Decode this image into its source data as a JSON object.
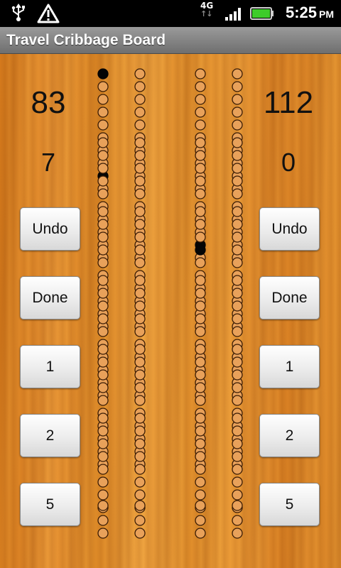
{
  "status_bar": {
    "network": "4G",
    "time": "5:25",
    "ampm": "PM",
    "icons": [
      "usb-icon",
      "warning-icon",
      "network-4g-icon",
      "signal-icon",
      "battery-icon"
    ]
  },
  "app": {
    "title": "Travel Cribbage Board"
  },
  "players": {
    "left": {
      "score": "83",
      "last": "7"
    },
    "right": {
      "score": "112",
      "last": "0"
    }
  },
  "buttons": {
    "left": [
      "Undo",
      "Done",
      "1",
      "2",
      "5"
    ],
    "right": [
      "Undo",
      "Done",
      "1",
      "2",
      "5"
    ]
  },
  "board": {
    "lanes": 4,
    "holes_per_lane": 60,
    "filled_pegs": [
      {
        "lane": 1,
        "hole": 1
      },
      {
        "lane": 1,
        "hole": 9
      },
      {
        "lane": 3,
        "hole": 19
      },
      {
        "lane": 3,
        "hole": 24
      }
    ],
    "colors": {
      "wood": "#e28f2c",
      "hole_fill": "#e8a15a",
      "hole_stroke": "#3a1c05",
      "peg": "#050505"
    }
  }
}
